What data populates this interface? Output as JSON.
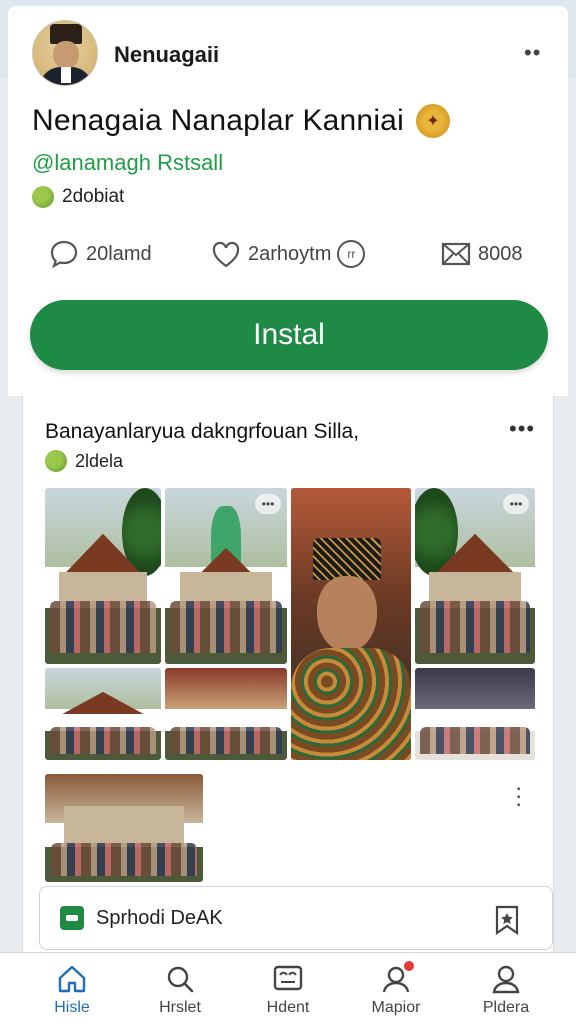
{
  "profile": {
    "username": "Nenuagaii",
    "title": "Nenagaia Nanaplar Kanniai",
    "handle": "@lanamagh Rstsall",
    "tag": "2dobiat",
    "stats": [
      {
        "icon": "comment-icon",
        "value": "20lamd"
      },
      {
        "icon": "heart-icon",
        "value": "2arhoytm"
      },
      {
        "icon": "mail-icon",
        "value": "8008"
      }
    ],
    "install_label": "Instal"
  },
  "post": {
    "title": "Banayanlaryua dakngrfouan Silla,",
    "tag": "2ldela",
    "app_banner": "Sprhodi DeAK"
  },
  "nav": [
    {
      "label": "Hisle",
      "icon": "home-icon",
      "active": true
    },
    {
      "label": "Hrslet",
      "icon": "search-icon",
      "active": false
    },
    {
      "label": "Hdent",
      "icon": "media-icon",
      "active": false
    },
    {
      "label": "Mapior",
      "icon": "notifications-icon",
      "active": false
    },
    {
      "label": "Pldera",
      "icon": "profile-icon",
      "active": false
    }
  ],
  "colors": {
    "accent_green": "#1e8a45",
    "handle_green": "#1f9d47",
    "nav_active": "#1f6fb8",
    "badge_red": "#e53935"
  }
}
